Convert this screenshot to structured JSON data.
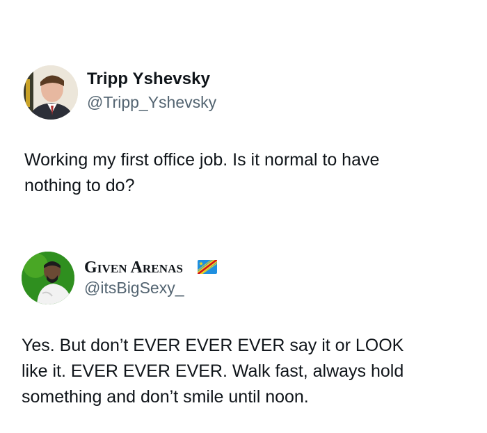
{
  "tweet1": {
    "display_name": "Tripp Yshevsky",
    "handle": "@Tripp_Yshevsky",
    "text": "Working my first office job. Is it normal to have\nnothing to do?"
  },
  "tweet2": {
    "display_name": "Given Arenas",
    "handle": "@itsBigSexy_",
    "flag_icon": "dr-congo-flag-icon",
    "text": "Yes. But don’t EVER EVER EVER say it or LOOK\nlike it. EVER EVER EVER. Walk fast, always hold\nsomething and don’t smile until noon."
  },
  "colors": {
    "text_primary": "#0f1419",
    "text_secondary": "#536471",
    "background": "#ffffff"
  }
}
